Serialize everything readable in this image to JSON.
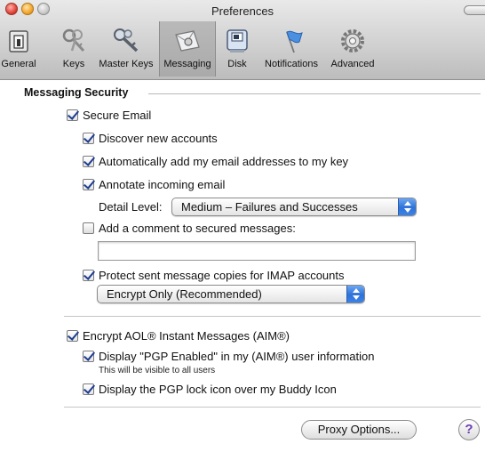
{
  "window": {
    "title": "Preferences"
  },
  "toolbar": {
    "items": [
      {
        "label": "General",
        "icon": "switch-icon"
      },
      {
        "label": "Keys",
        "icon": "keys-icon"
      },
      {
        "label": "Master Keys",
        "icon": "master-keys-icon"
      },
      {
        "label": "Messaging",
        "icon": "messaging-icon",
        "selected": true
      },
      {
        "label": "Disk",
        "icon": "disk-icon"
      },
      {
        "label": "Notifications",
        "icon": "notifications-flag-icon"
      },
      {
        "label": "Advanced",
        "icon": "gear-icon"
      }
    ]
  },
  "messaging_security": {
    "title": "Messaging Security",
    "secure_email": {
      "label": "Secure Email",
      "checked": true
    },
    "discover_accounts": {
      "label": "Discover new accounts",
      "checked": true
    },
    "auto_add_addresses": {
      "label": "Automatically add my email addresses to my key",
      "checked": true
    },
    "annotate_incoming": {
      "label": "Annotate incoming email",
      "checked": true
    },
    "detail_level": {
      "label": "Detail Level:",
      "value": "Medium – Failures and Successes"
    },
    "add_comment": {
      "label": "Add a comment to secured messages:",
      "checked": false,
      "value": ""
    },
    "protect_sent": {
      "label": "Protect sent message copies for IMAP accounts",
      "checked": true
    },
    "protect_mode": {
      "value": "Encrypt Only (Recommended)"
    },
    "encrypt_aim": {
      "label": "Encrypt AOL® Instant Messages (AIM®)",
      "checked": true
    },
    "display_pgp_enabled": {
      "label": "Display \"PGP Enabled\" in my (AIM®) user information",
      "checked": true,
      "note": "This will be visible to all users"
    },
    "display_lock_icon": {
      "label": "Display the PGP lock icon over my Buddy Icon",
      "checked": true
    }
  },
  "buttons": {
    "proxy_options": "Proxy Options...",
    "help": "?"
  },
  "colors": {
    "check_mark": "#1d3c91",
    "popup_stepper": "#2f72d8",
    "help_glyph": "#6b3fb2"
  }
}
